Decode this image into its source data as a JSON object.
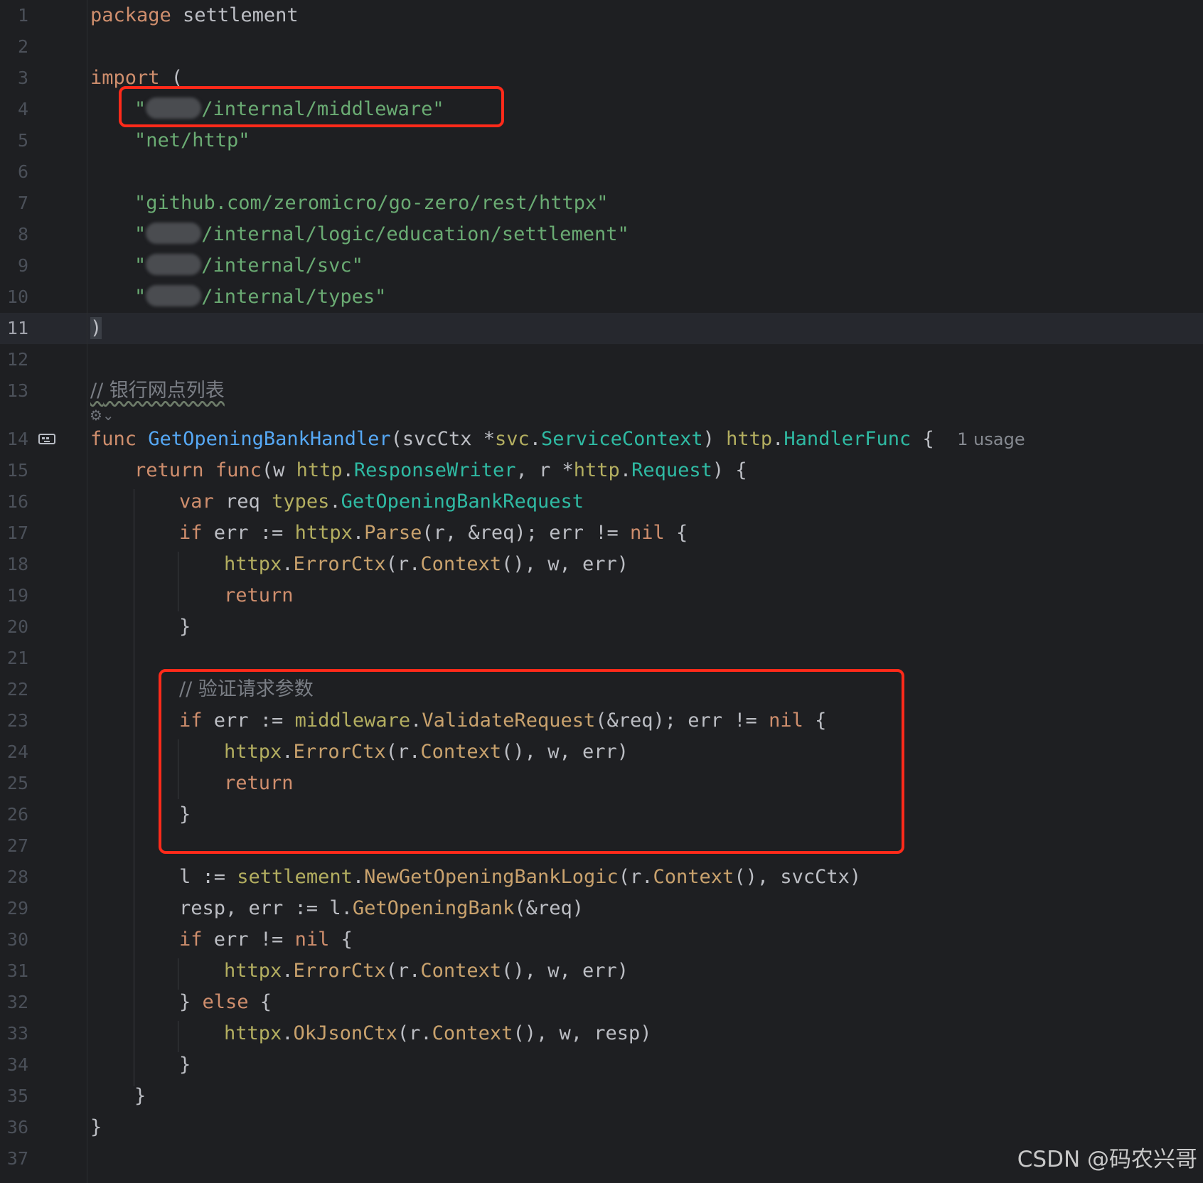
{
  "editor": {
    "line_numbers": [
      "1",
      "2",
      "3",
      "4",
      "5",
      "6",
      "7",
      "8",
      "9",
      "10",
      "11",
      "12",
      "13",
      "14",
      "15",
      "16",
      "17",
      "18",
      "19",
      "20",
      "21",
      "22",
      "23",
      "24",
      "25",
      "26",
      "27",
      "28",
      "29",
      "30",
      "31",
      "32",
      "33",
      "34",
      "35",
      "36",
      "37"
    ],
    "lines": {
      "l1": {
        "kw": "package",
        "rest": " settlement"
      },
      "l3": {
        "kw": "import",
        "rest": " ("
      },
      "l4": {
        "q": "\"",
        "path": "/internal/middleware\""
      },
      "l5": {
        "s": "\"net/http\""
      },
      "l7": {
        "s": "\"github.com/zeromicro/go-zero/rest/httpx\""
      },
      "l8": {
        "q": "\"",
        "path": "/internal/logic/education/settlement\""
      },
      "l9": {
        "q": "\"",
        "path": "/internal/svc\""
      },
      "l10": {
        "q": "\"",
        "path": "/internal/types\""
      },
      "l11": {
        "t": ")"
      },
      "l13": {
        "c1": "//",
        "c2": " 银行网点列表"
      },
      "l14": {
        "a": "func",
        "b": " ",
        "c": "GetOpeningBankHandler",
        "d": "(svcCtx *",
        "e": "svc",
        ".": ".",
        "f": "ServiceContext",
        "g": ") ",
        "h": "http",
        "i": ".",
        "j": "HandlerFunc",
        "k": " {",
        "usage": "1 usage"
      },
      "l15": {
        "a": "return",
        "b": " ",
        "c": "func",
        "d": "(w ",
        "e": "http",
        "f": ".",
        "g": "ResponseWriter",
        "h": ", r *",
        "i": "http",
        "j": ".",
        "k": "Request",
        "l": ") {"
      },
      "l16": {
        "a": "var",
        "b": " req ",
        "c": "types",
        "d": ".",
        "e": "GetOpeningBankRequest"
      },
      "l17": {
        "a": "if",
        "b": " err := ",
        "c": "httpx",
        "d": ".",
        "e": "Parse",
        "f": "(r, &req); err != ",
        "g": "nil",
        "h": " {"
      },
      "l18": {
        "a": "httpx",
        "b": ".",
        "c": "ErrorCtx",
        "d": "(r.",
        "e": "Context",
        "f": "(), w, err)"
      },
      "l19": {
        "a": "return"
      },
      "l20": {
        "t": "}"
      },
      "l22": {
        "t": "// 验证请求参数"
      },
      "l23": {
        "a": "if",
        "b": " err := ",
        "c": "middleware",
        "d": ".",
        "e": "ValidateRequest",
        "f": "(&req); err != ",
        "g": "nil",
        "h": " {"
      },
      "l24": {
        "a": "httpx",
        "b": ".",
        "c": "ErrorCtx",
        "d": "(r.",
        "e": "Context",
        "f": "(), w, err)"
      },
      "l25": {
        "a": "return"
      },
      "l26": {
        "t": "}"
      },
      "l28": {
        "a": "l := ",
        "b": "settlement",
        "c": ".",
        "d": "NewGetOpeningBankLogic",
        "e": "(r.",
        "f": "Context",
        "g": "(), svcCtx)"
      },
      "l29": {
        "a": "resp, err := l.",
        "b": "GetOpeningBank",
        "c": "(&req)"
      },
      "l30": {
        "a": "if",
        "b": " err != ",
        "c": "nil",
        "d": " {"
      },
      "l31": {
        "a": "httpx",
        "b": ".",
        "c": "ErrorCtx",
        "d": "(r.",
        "e": "Context",
        "f": "(), w, err)"
      },
      "l32": {
        "a": "} ",
        "b": "else",
        "c": " {"
      },
      "l33": {
        "a": "httpx",
        "b": ".",
        "c": "OkJsonCtx",
        "d": "(r.",
        "e": "Context",
        "f": "(), w, resp)"
      },
      "l34": {
        "t": "}"
      },
      "l35": {
        "t": "}"
      },
      "l36": {
        "t": "}"
      }
    },
    "current_line": "11",
    "gutter_icons": {
      "line14": "interface-implementation-icon",
      "line13": "ai-assistant-icon"
    }
  },
  "annotations": {
    "highlight_color": "#ff2a1a"
  },
  "watermark": "CSDN @码农兴哥"
}
